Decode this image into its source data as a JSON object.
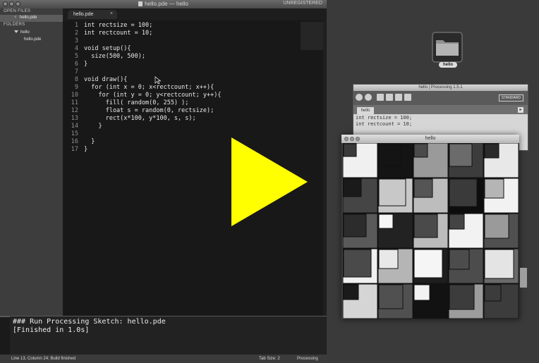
{
  "sublime": {
    "window_title": "hello.pde — hello",
    "unregistered": "UNREGISTERED",
    "sidebar": {
      "open_files_label": "OPEN FILES",
      "open_file": "hello.pde",
      "folders_label": "FOLDERS",
      "folder": "hello",
      "folder_file": "hello.pde"
    },
    "tab": {
      "label": "hello.pde"
    },
    "code_lines": [
      "int rectsize = 100;",
      "int rectcount = 10;",
      "",
      "void setup(){",
      "  size(500, 500);",
      "}",
      "",
      "void draw(){",
      "  for (int x = 0; x<rectcount; x++){",
      "    for (int y = 0; y<rectcount; y++){",
      "      fill( random(0, 255) );",
      "      float s = random(0, rectsize);",
      "      rect(x*100, y*100, s, s);",
      "    }",
      "",
      "  }",
      "}"
    ],
    "line_numbers": [
      "1",
      "2",
      "3",
      "4",
      "5",
      "6",
      "7",
      "8",
      "9",
      "10",
      "11",
      "12",
      "13",
      "14",
      "15",
      "16",
      "17"
    ],
    "console": [
      "### Run Processing Sketch: hello.pde",
      "[Finished in 1.0s]"
    ],
    "status": {
      "position": "Line 13, Column 24; Build finished",
      "tab_size": "Tab Size: 2",
      "syntax": "Processing"
    }
  },
  "desktop": {
    "folder_label": "hello"
  },
  "processing": {
    "title": "hello | Processing 1.5.1",
    "mode": "STANDARD",
    "tab": "hello",
    "code": [
      "int rectsize = 100;",
      "int rectcount = 10;"
    ]
  },
  "sketch": {
    "title": "hello",
    "cells": [
      [
        "#f0f0f0",
        "#141414",
        "#9a9a9a",
        "#3c3c3c",
        "#e8e8e8"
      ],
      [
        "#454545",
        "#c8c8c8",
        "#bdbdbd",
        "#0d0d0d",
        "#f2f2f2"
      ],
      [
        "#5a5a5a",
        "#222222",
        "#bcbcbc",
        "#f2f2f2",
        "#505050"
      ],
      [
        "#f0f0f0",
        "#b5b5b5",
        "#1e1e1e",
        "#4c4c4c",
        "#6a6a6a"
      ],
      [
        "#d5d5d5",
        "#505050",
        "#121212",
        "#9c9c9c",
        "#3c3c3c"
      ]
    ],
    "inner": [
      [
        "#3a3a3a",
        "#141414",
        "#4a4a4a",
        "#6b6b6b",
        "#2a2a2a"
      ],
      [
        "#1a1a1a",
        "#c8c8c8",
        "#555555",
        "#3a3a3a",
        "#b5b5b5"
      ],
      [
        "#2c2c2c",
        "#f5f5f5",
        "#4a4a4a",
        "#444444",
        "#9a9a9a"
      ],
      [
        "#4a4a4a",
        "#e8e8e8",
        "#f5f5f5",
        "#4c4c4c",
        "#e4e4e4"
      ],
      [
        "#1a1a1a",
        "#505050",
        "#f2f2f2",
        "#3c3c3c",
        "#3c3c3c"
      ]
    ]
  },
  "colors": {
    "play": "#ffff00"
  }
}
